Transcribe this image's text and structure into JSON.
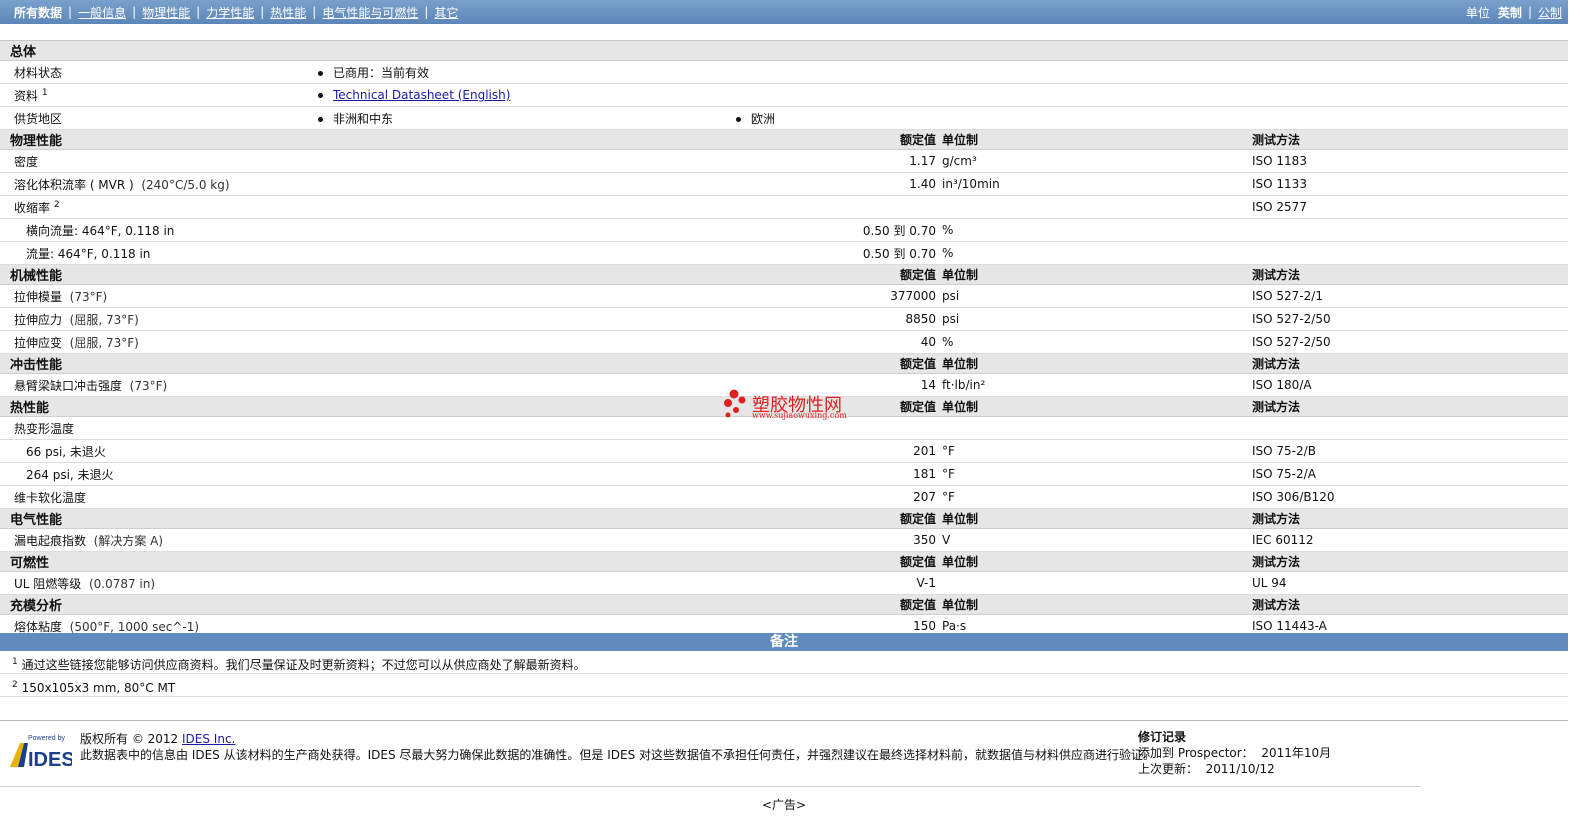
{
  "nav": {
    "tabs": [
      "所有数据",
      "一般信息",
      "物理性能",
      "力学性能",
      "热性能",
      "电气性能与可燃性",
      "其它"
    ],
    "unit_label": "单位",
    "unit_en": "英制",
    "unit_metric": "公制"
  },
  "general": {
    "title": "总体",
    "material_status_label": "材料状态",
    "material_status_value": "已商用：当前有效",
    "literature_label": "资料",
    "literature_sup": "1",
    "literature_link": "Technical Datasheet (English)",
    "supply_label": "供货地区",
    "supply_values": [
      "非洲和中东",
      "欧洲"
    ]
  },
  "headers": {
    "nominal": "额定值",
    "unit": "单位制",
    "test": "测试方法"
  },
  "sections": {
    "physical": {
      "title": "物理性能",
      "rows": [
        {
          "name": "密度",
          "value": "1.17",
          "unit": "g/cm³",
          "method": "ISO 1183"
        },
        {
          "name": "溶化体积流率 ( MVR )",
          "cond": "(240°C/5.0 kg)",
          "value": "1.40",
          "unit": "in³/10min",
          "method": "ISO 1133"
        },
        {
          "name": "收缩率",
          "sup": "2",
          "value": "",
          "unit": "",
          "method": "ISO 2577"
        },
        {
          "name": "横向流量: 464°F, 0.118 in",
          "value": "0.50 到 0.70",
          "unit": "%",
          "method": ""
        },
        {
          "name": "流量: 464°F, 0.118 in",
          "value": "0.50 到 0.70",
          "unit": "%",
          "method": ""
        }
      ]
    },
    "mechanical": {
      "title": "机械性能",
      "rows": [
        {
          "name": "拉伸模量",
          "cond": "(73°F)",
          "value": "377000",
          "unit": "psi",
          "method": "ISO 527-2/1"
        },
        {
          "name": "拉伸应力",
          "cond": "(屈服, 73°F)",
          "value": "8850",
          "unit": "psi",
          "method": "ISO 527-2/50"
        },
        {
          "name": "拉伸应变",
          "cond": "(屈服, 73°F)",
          "value": "40",
          "unit": "%",
          "method": "ISO 527-2/50"
        }
      ]
    },
    "impact": {
      "title": "冲击性能",
      "rows": [
        {
          "name": "悬臂梁缺口冲击强度",
          "cond": "(73°F)",
          "value": "14",
          "unit": "ft·lb/in²",
          "method": "ISO 180/A"
        }
      ]
    },
    "thermal": {
      "title": "热性能",
      "rows": [
        {
          "name": "热变形温度",
          "value": "",
          "unit": "",
          "method": ""
        },
        {
          "name": "66 psi, 未退火",
          "value": "201",
          "unit": "°F",
          "method": "ISO 75-2/B"
        },
        {
          "name": "264 psi, 未退火",
          "value": "181",
          "unit": "°F",
          "method": "ISO 75-2/A"
        },
        {
          "name": "维卡软化温度",
          "value": "207",
          "unit": "°F",
          "method": "ISO 306/B120"
        }
      ]
    },
    "electrical": {
      "title": "电气性能",
      "rows": [
        {
          "name": "漏电起痕指数",
          "cond": "(解决方案 A)",
          "value": "350",
          "unit": "V",
          "method": "IEC 60112"
        }
      ]
    },
    "flammability": {
      "title": "可燃性",
      "rows": [
        {
          "name": "UL 阻燃等级",
          "cond": "(0.0787 in)",
          "value": "V-1",
          "unit": "",
          "method": "UL 94"
        }
      ]
    },
    "mold": {
      "title": "充模分析",
      "rows": [
        {
          "name": "熔体粘度",
          "cond": "(500°F, 1000 sec^-1)",
          "value": "150",
          "unit": "Pa·s",
          "method": "ISO 11443-A"
        }
      ]
    }
  },
  "remarks": {
    "title": "备注",
    "items": [
      {
        "sup": "1",
        "text": "通过这些链接您能够访问供应商资料。我们尽量保证及时更新资料；不过您可以从供应商处了解最新资料。"
      },
      {
        "sup": "2",
        "text": "150x105x3 mm, 80°C MT"
      }
    ]
  },
  "footer": {
    "logo_small": "Powered by",
    "logo_text": "IDES",
    "copyright_prefix": "版权所有 © 2012",
    "copyright_link": "IDES Inc.",
    "disclaimer": "此数据表中的信息由 IDES 从该材料的生产商处获得。IDES 尽最大努力确保此数据的准确性。但是 IDES 对这些数据值不承担任何责任，并强烈建议在最终选择材料前，就数据值与材料供应商进行验证。",
    "rev_title": "修订记录",
    "rev_added_label": "添加到 Prospector：",
    "rev_added_value": "2011年10月",
    "rev_updated_label": "上次更新：",
    "rev_updated_value": "2011/10/12",
    "ad": "<广告>"
  },
  "watermark": {
    "cn": "塑胶物性网",
    "url": "www.sujiaowuxing.com"
  },
  "colors": {
    "nav": "#6b94c3",
    "section": "#e6e6e6",
    "remarks": "#5f8cbd",
    "link": "#1a1aa8",
    "watermark": "#e02020"
  }
}
